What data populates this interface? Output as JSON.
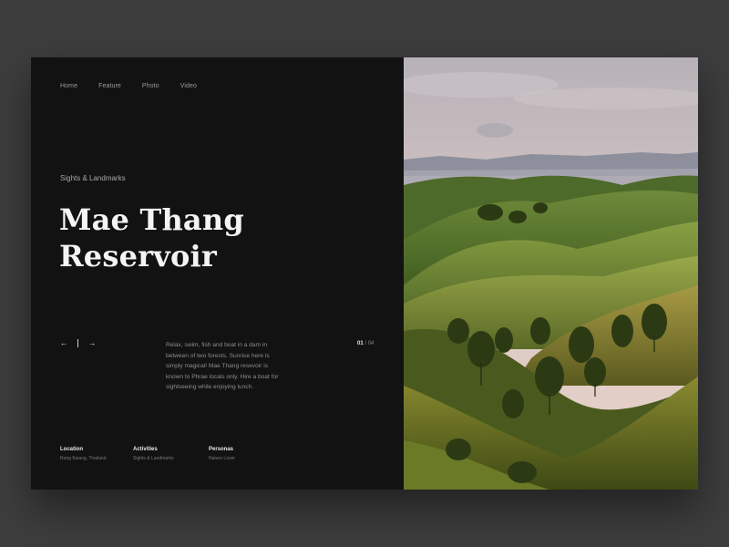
{
  "nav": {
    "items": [
      "Home",
      "Feature",
      "Photo",
      "Video"
    ]
  },
  "hero": {
    "category": "Sights & Landmarks",
    "title_line1": "Mae Thang",
    "title_line2": "Reservoir",
    "description": "Relax, swim, fish and boat in a dam in between of two forests. Sunrise here is simply magical! Mae Thang resevoir is known to Phrae locals only.  Hire a boat for sightseeing while enjoying lunch."
  },
  "pager": {
    "prev_icon": "arrow-left-icon",
    "next_icon": "arrow-right-icon",
    "prev_glyph": "←",
    "next_glyph": "→",
    "current": "01",
    "separator": "/",
    "total": "04"
  },
  "meta": {
    "location": {
      "label": "Location",
      "value": "Rong Kwang, Thailand"
    },
    "activities": {
      "label": "Activities",
      "value": "Sights & Landmarks"
    },
    "personas": {
      "label": "Personas",
      "value": "Nature Lover"
    }
  },
  "colors": {
    "page_background": "#3d3d3d",
    "panel_background": "#121212",
    "title": "#f4f4f4",
    "muted_text": "#8e8e8e"
  }
}
